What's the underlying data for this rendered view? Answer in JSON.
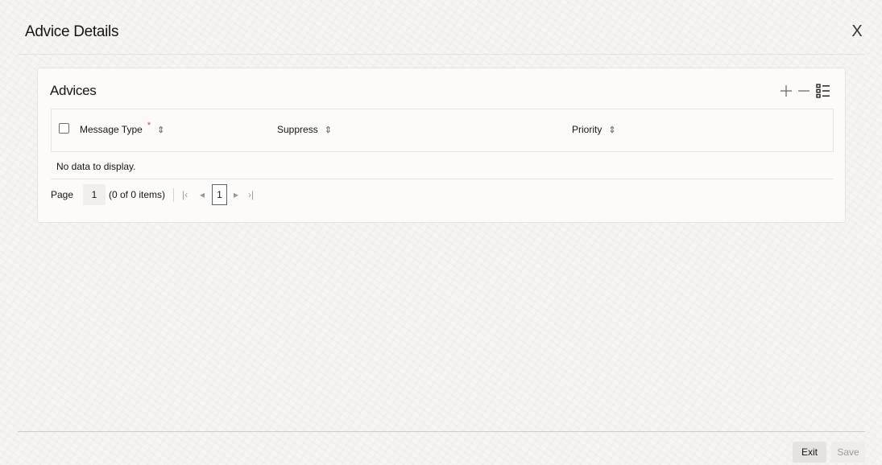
{
  "dialog": {
    "title": "Advice Details",
    "close_label": "X"
  },
  "advices": {
    "title": "Advices",
    "toolbar": {
      "add": "+",
      "remove": "—"
    },
    "columns": [
      {
        "label": "Message Type",
        "required": "*",
        "sortable": true
      },
      {
        "label": "Suppress",
        "sortable": true
      },
      {
        "label": "Priority",
        "sortable": true
      }
    ],
    "sort_icon": "⇕",
    "empty_message": "No data to display.",
    "pagination": {
      "page_label": "Page",
      "page_value": "1",
      "count_text": "(0 of 0 items)",
      "first": "|‹",
      "prev": "◂",
      "current": "1",
      "next": "▸",
      "last": "›|"
    }
  },
  "footer": {
    "exit_label": "Exit",
    "save_label": "Save"
  },
  "colors": {
    "required": "#c74634",
    "background": "#f6f5f3"
  }
}
